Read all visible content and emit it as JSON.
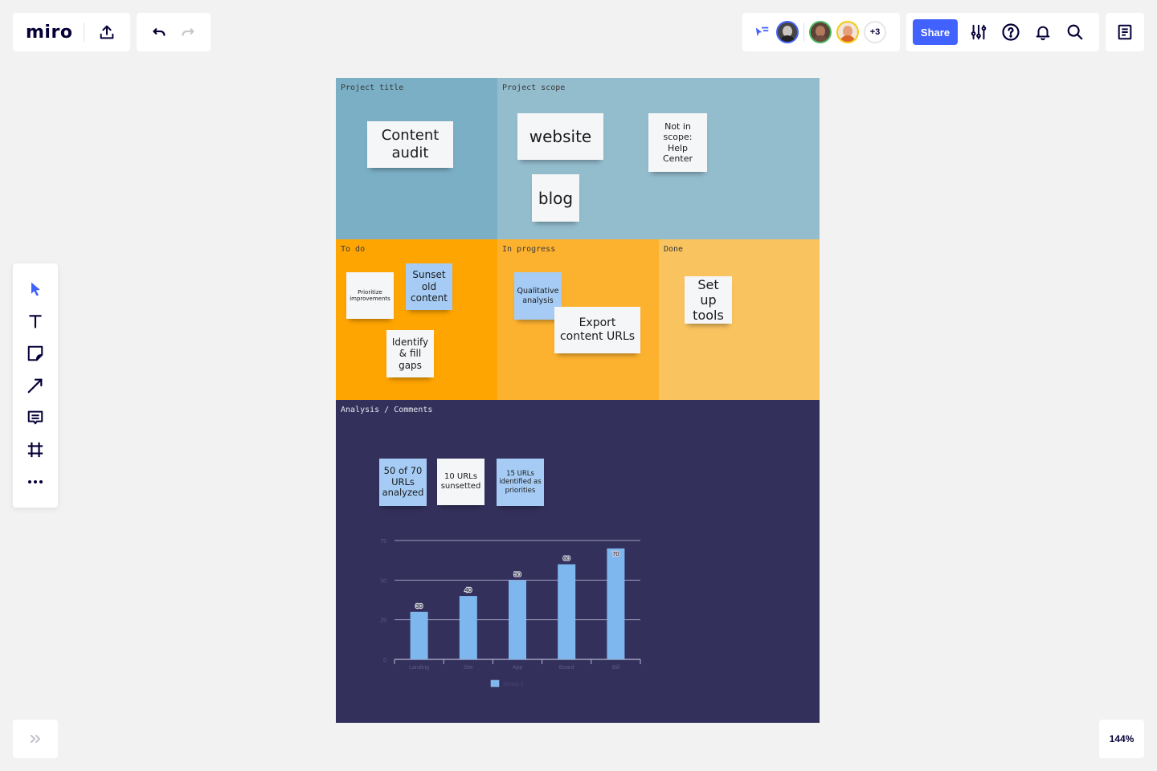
{
  "app": {
    "logo": "miro"
  },
  "topbar": {
    "share_label": "Share",
    "more_collaborators": "+3",
    "avatars": [
      {
        "name": "collaborator-1",
        "ring": "#4262ff",
        "skin": "#c9c4c0",
        "shirt": "#222222"
      },
      {
        "name": "collaborator-2",
        "ring": "#4cb862",
        "skin": "#b07a5e",
        "shirt": "#6d4c3d"
      },
      {
        "name": "collaborator-3",
        "ring": "#fac710",
        "skin": "#e5a07a",
        "shirt": "#d9652b"
      }
    ],
    "icons": [
      "export-icon",
      "undo-icon",
      "redo-icon",
      "cursor-follow-icon",
      "settings-sliders-icon",
      "help-icon",
      "notifications-bell-icon",
      "search-icon",
      "notes-icon"
    ]
  },
  "toolbar": {
    "tools": [
      "select",
      "text",
      "sticky-note",
      "arrow",
      "comment",
      "frame",
      "more"
    ]
  },
  "zoom_level": "144%",
  "board": {
    "zones": {
      "title": "Project title",
      "scope": "Project scope",
      "todo": "To do",
      "progress": "In progress",
      "done": "Done",
      "analysis": "Analysis / Comments"
    },
    "stickies": {
      "content_audit": "Content audit",
      "website": "website",
      "blog": "blog",
      "not_in_scope": "Not in scope: Help Center",
      "prioritize": "Prioritize improvements",
      "sunset": "Sunset old content",
      "identify": "Identify & fill gaps",
      "qualitative": "Qualitative analysis",
      "export": "Export content URLs",
      "setup": "Set up tools",
      "analyzed": "50 of 70 URLs analyzed",
      "sunsetted": "10 URLs sunsetted",
      "priorities": "15 URLs identified as priorities"
    }
  },
  "colors": {
    "accent": "#4262ff",
    "bar": "#7eb6ee",
    "analysis_bg": "#33305b"
  },
  "chart_data": {
    "type": "bar",
    "title": "",
    "categories": [
      "Landing",
      "Site",
      "App",
      "Board",
      "Bill"
    ],
    "values": [
      30,
      40,
      50,
      60,
      70
    ],
    "series": [
      {
        "name": "Series 1",
        "values": [
          30,
          40,
          50,
          60,
          70
        ]
      }
    ],
    "yticks": [
      "0",
      "25",
      "50",
      "75"
    ],
    "ylim": [
      0,
      75
    ],
    "xlabel": "",
    "ylabel": "",
    "grid": true,
    "legend": "bottom-center"
  }
}
